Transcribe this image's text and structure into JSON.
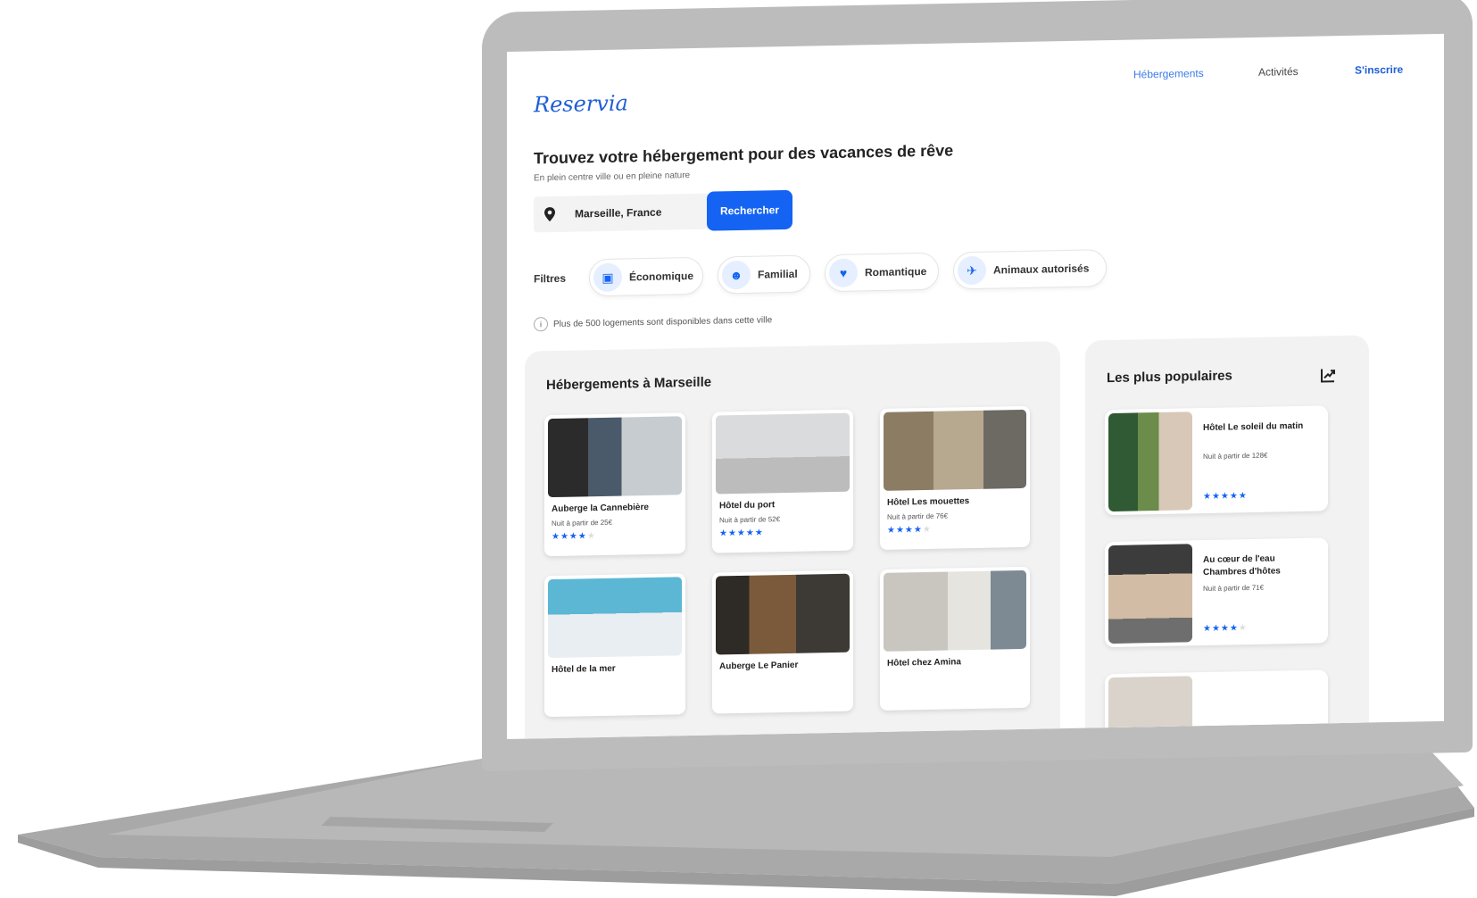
{
  "brand": {
    "logo": "Reservia"
  },
  "nav": {
    "items": [
      {
        "label": "Hébergements",
        "active": true
      },
      {
        "label": "Activités",
        "active": false
      },
      {
        "label": "S'inscrire",
        "active": false
      }
    ]
  },
  "hero": {
    "title": "Trouvez votre hébergement pour des vacances de rêve",
    "subtitle": "En plein centre ville ou en pleine nature"
  },
  "search": {
    "value": "Marseille, France",
    "button": "Rechercher"
  },
  "filters": {
    "label": "Filtres",
    "chips": [
      {
        "label": "Économique",
        "icon": "money-icon"
      },
      {
        "label": "Familial",
        "icon": "family-icon"
      },
      {
        "label": "Romantique",
        "icon": "heart-icon"
      },
      {
        "label": "Animaux autorisés",
        "icon": "pet-icon"
      }
    ]
  },
  "info": {
    "text": "Plus de 500 logements sont disponibles dans cette ville"
  },
  "listings": {
    "title": "Hébergements à Marseille",
    "cards": [
      {
        "name": "Auberge la Cannebière",
        "price": "Nuit à partir de 25€",
        "rating": 4
      },
      {
        "name": "Hôtel du port",
        "price": "Nuit à partir de 52€",
        "rating": 5
      },
      {
        "name": "Hôtel Les mouettes",
        "price": "Nuit à partir de 76€",
        "rating": 4
      },
      {
        "name": "Hôtel de la mer",
        "price": "",
        "rating": 0
      },
      {
        "name": "Auberge Le Panier",
        "price": "",
        "rating": 0
      },
      {
        "name": "Hôtel chez Amina",
        "price": "",
        "rating": 0
      }
    ]
  },
  "popular": {
    "title": "Les plus populaires",
    "icon": "trend-icon",
    "cards": [
      {
        "name": "Hôtel Le soleil du matin",
        "price": "Nuit à partir de 128€",
        "rating": 5
      },
      {
        "name": "Au cœur de l'eau Chambres d'hôtes",
        "price": "Nuit à partir de 71€",
        "rating": 4
      }
    ]
  },
  "colors": {
    "accent": "#1463f3",
    "chip_icon_bg": "#e6efff",
    "panel_bg": "#f2f2f2",
    "frame": "#bcbcbc"
  }
}
